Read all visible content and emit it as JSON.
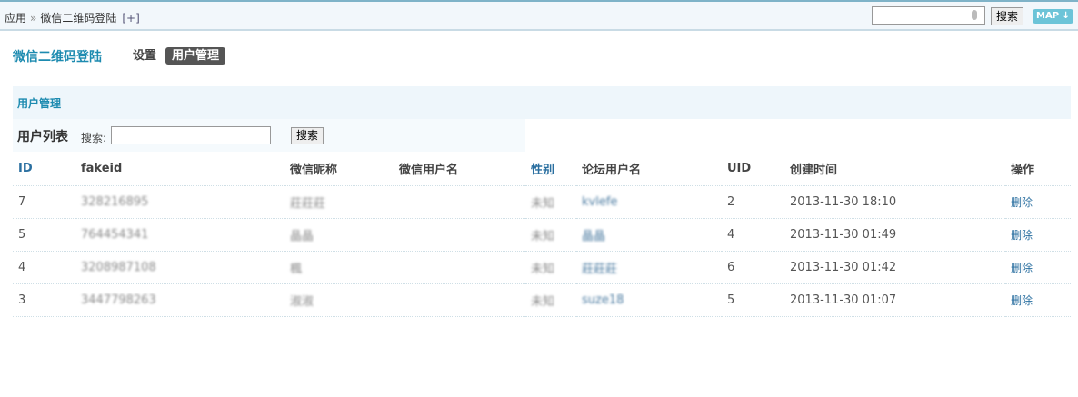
{
  "breadcrumb": {
    "root": "应用",
    "sep": "»",
    "current": "微信二维码登陆",
    "add": "[+]"
  },
  "topsearch": {
    "value": "",
    "button": "搜索",
    "map": "MAP ↓"
  },
  "app": {
    "title": "微信二维码登陆",
    "tabs": [
      {
        "label": "设置",
        "active": false
      },
      {
        "label": "用户管理",
        "active": true
      }
    ]
  },
  "panel": {
    "title": "用户管理",
    "list_title": "用户列表",
    "search_label": "搜索:",
    "search_value": "",
    "search_button": "搜索"
  },
  "table": {
    "headers": [
      "ID",
      "fakeid",
      "微信昵称",
      "微信用户名",
      "性别",
      "论坛用户名",
      "UID",
      "创建时间",
      "操作"
    ],
    "rows": [
      {
        "id": "7",
        "fakeid": "328216895",
        "nick": "莊莊莊",
        "wxname": "",
        "gender": "未知",
        "forum": "kvlefe",
        "uid": "2",
        "time": "2013-11-30 18:10",
        "action": "删除"
      },
      {
        "id": "5",
        "fakeid": "764454341",
        "nick": "晶晶",
        "wxname": "",
        "gender": "未知",
        "forum": "晶晶",
        "uid": "4",
        "time": "2013-11-30 01:49",
        "action": "删除"
      },
      {
        "id": "4",
        "fakeid": "3208987108",
        "nick": "楓",
        "wxname": "",
        "gender": "未知",
        "forum": "莊莊莊",
        "uid": "6",
        "time": "2013-11-30 01:42",
        "action": "删除"
      },
      {
        "id": "3",
        "fakeid": "3447798263",
        "nick": "淑淑",
        "wxname": "",
        "gender": "未知",
        "forum": "suze18",
        "uid": "5",
        "time": "2013-11-30 01:07",
        "action": "删除"
      }
    ]
  }
}
